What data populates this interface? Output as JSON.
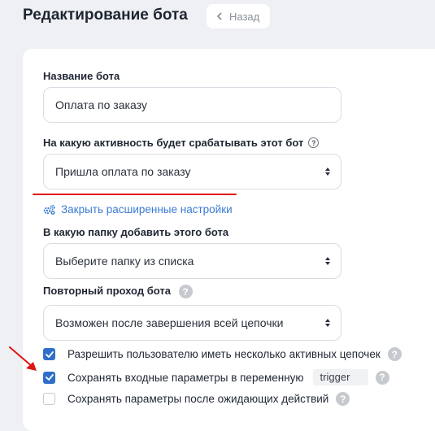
{
  "header": {
    "title": "Редактирование бота",
    "back_label": "Назад"
  },
  "form": {
    "bot_name_label": "Название бота",
    "bot_name_value": "Оплата по заказу",
    "trigger_label": "На какую активность будет срабатывать этот бот",
    "trigger_value": "Пришла оплата по заказу",
    "advanced_link": "Закрыть расширенные настройки",
    "folder_label": "В какую папку добавить этого бота",
    "folder_value": "Выберите папку из списка",
    "repeat_label": "Повторный проход бота",
    "repeat_value": "Возможен после завершения всей цепочки",
    "help_glyph": "?"
  },
  "checkboxes": [
    {
      "label": "Разрешить пользователю иметь несколько активных цепочек",
      "checked": true
    },
    {
      "label": "Сохранять входные параметры в переменную",
      "checked": true,
      "variable_value": "trigger"
    },
    {
      "label": "Сохранять параметры после ожидающих действий",
      "checked": false
    }
  ],
  "colors": {
    "accent": "#2f6fc9",
    "link": "#3a7bd5",
    "annotation_red": "#e01414",
    "background": "#eef0f4"
  }
}
